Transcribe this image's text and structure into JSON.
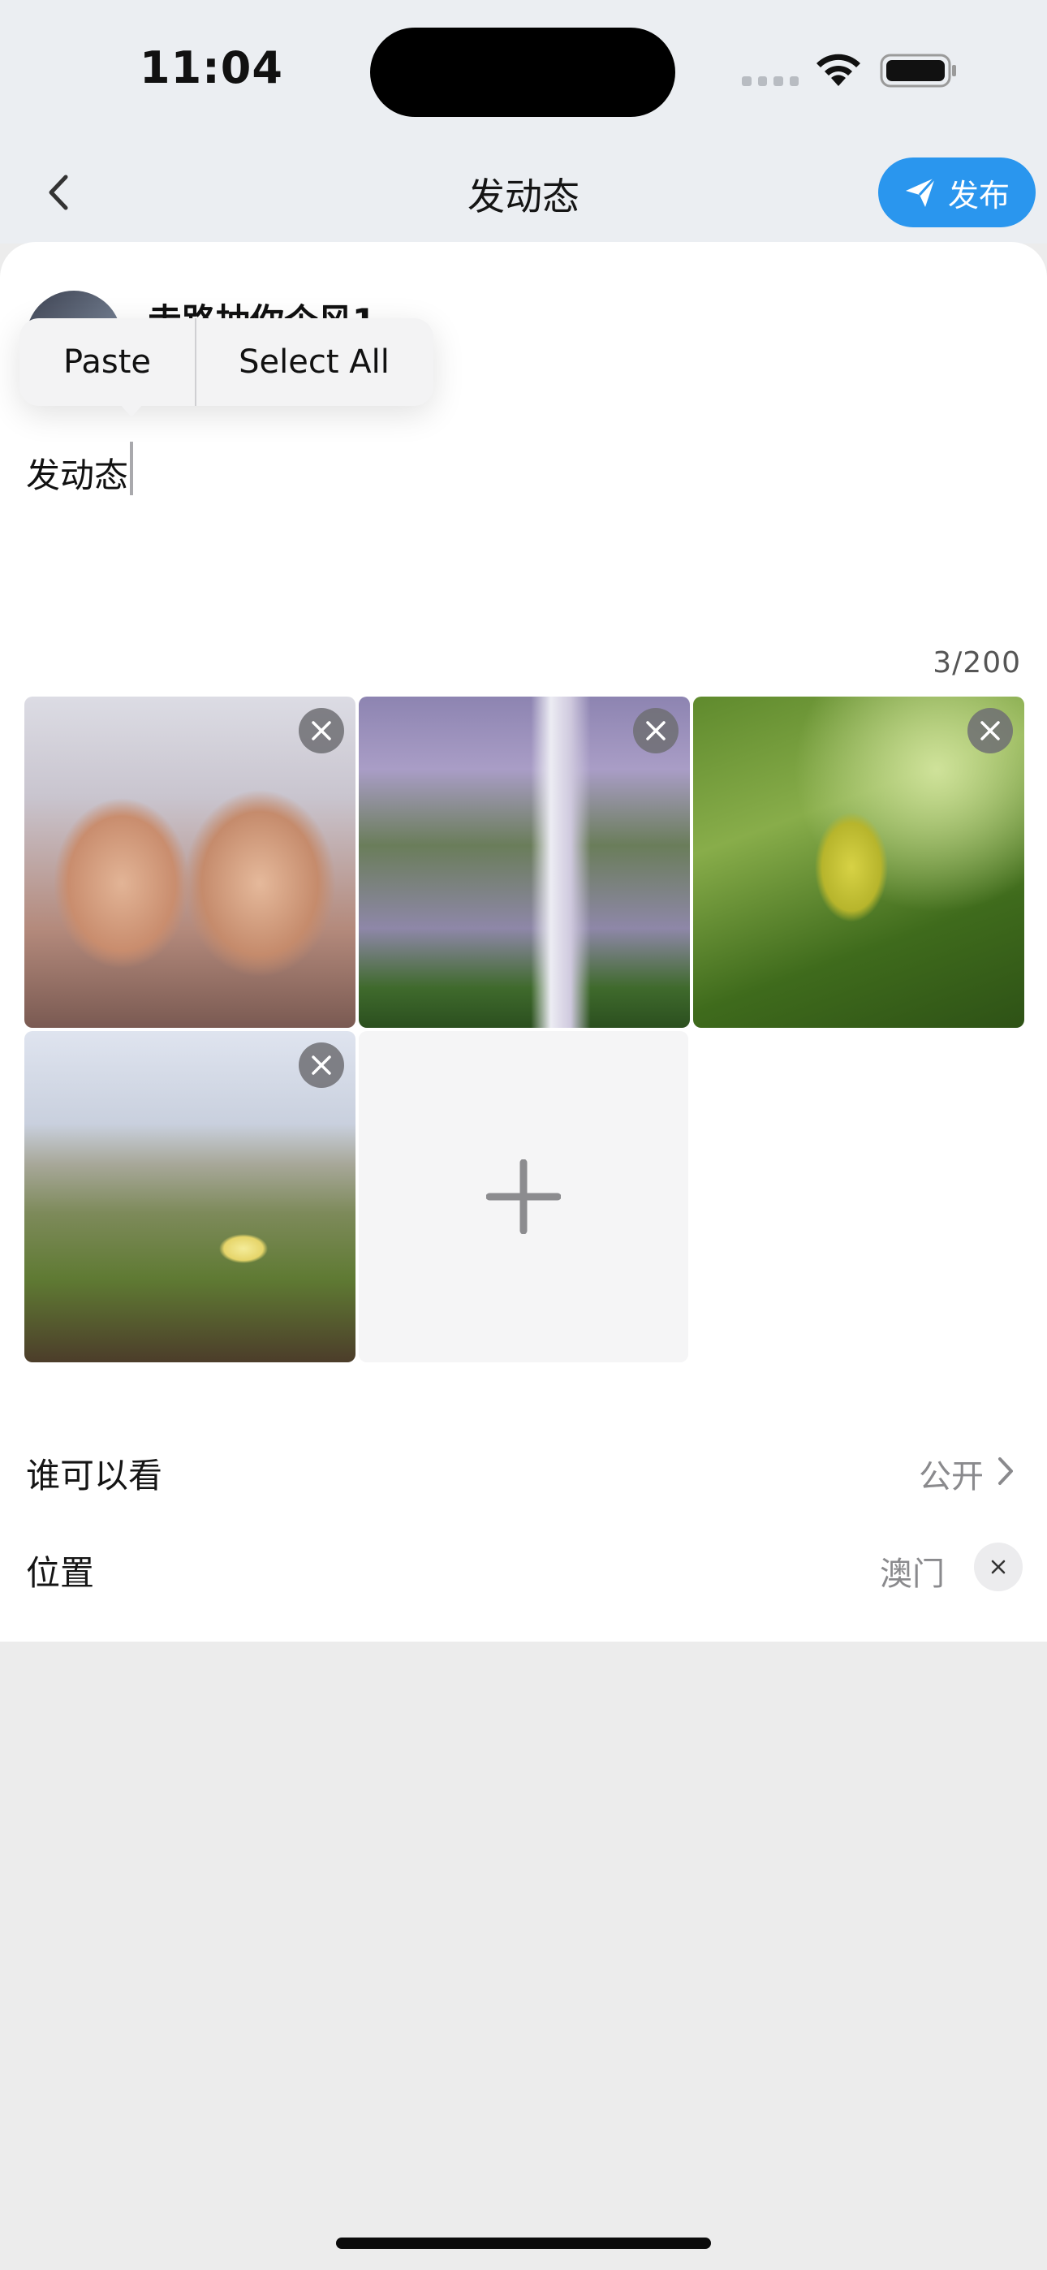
{
  "status": {
    "time": "11:04"
  },
  "nav": {
    "title": "发动态",
    "publish_label": "发布"
  },
  "user": {
    "name": "走路抽你个风1"
  },
  "context_menu": {
    "paste_label": "Paste",
    "select_all_label": "Select All"
  },
  "compose": {
    "text": "发动态",
    "counter": "3/200"
  },
  "settings": {
    "visibility_label": "谁可以看",
    "visibility_value": "公开",
    "location_label": "位置",
    "location_value": "澳门"
  },
  "icons": {
    "back": "chevron-left-icon",
    "publish": "send-icon",
    "remove": "close-icon",
    "add": "plus-icon",
    "disclosure": "chevron-right-icon"
  },
  "colors": {
    "accent": "#2a96ee",
    "page_bg": "#ececec",
    "card_bg": "#ffffff"
  }
}
